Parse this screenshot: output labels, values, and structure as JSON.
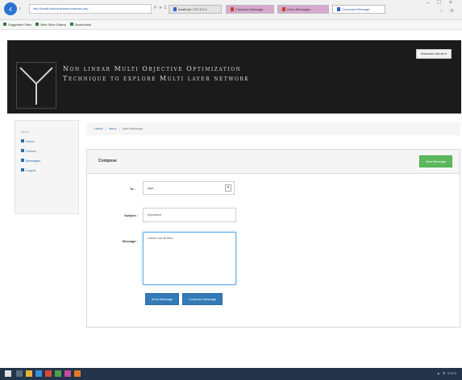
{
  "browser": {
    "address": "http://localhost/nonlinear/compose.php",
    "addr_tools": "P ▾ C",
    "tabs": [
      {
        "label": "localhost / 127.0.0.1"
      },
      {
        "label": "Compose Message"
      },
      {
        "label": "Inbox Messages"
      },
      {
        "label": "Compose Message"
      }
    ],
    "window_controls": "– □ ×",
    "window_icons": "☆ ⚙",
    "bookmarks": [
      "Suggested Sites",
      "Web Slice Gallery",
      "Bookmarks"
    ]
  },
  "header": {
    "title_line1": "Non linear Multi Objective Optimization",
    "title_line2": "Technique to explore Multi layer network",
    "user_button": "Welcome Admin ▾"
  },
  "sidebar": {
    "items": [
      {
        "label": "Inbox",
        "muted": true
      },
      {
        "label": "Home"
      },
      {
        "label": "Outbox"
      },
      {
        "label": "Messages"
      },
      {
        "label": "Logout"
      }
    ]
  },
  "breadcrumb": [
    "Home",
    "Inbox",
    "New Message"
  ],
  "panel": {
    "title": "Compose",
    "header_button": "New Message"
  },
  "form": {
    "to_label": "To :",
    "to_value": "user",
    "subject_label": "Subject :",
    "subject_value": "Important",
    "message_label": "Message :",
    "message_value": "Check out all files",
    "send_button": "Send Message",
    "cancel_button": "Compose Message"
  },
  "taskbar": {
    "tray": "▲ ⇅ ENG"
  },
  "colors": {
    "header_bg": "#1b1b1b",
    "primary": "#337ab7",
    "success": "#5cb85c"
  }
}
